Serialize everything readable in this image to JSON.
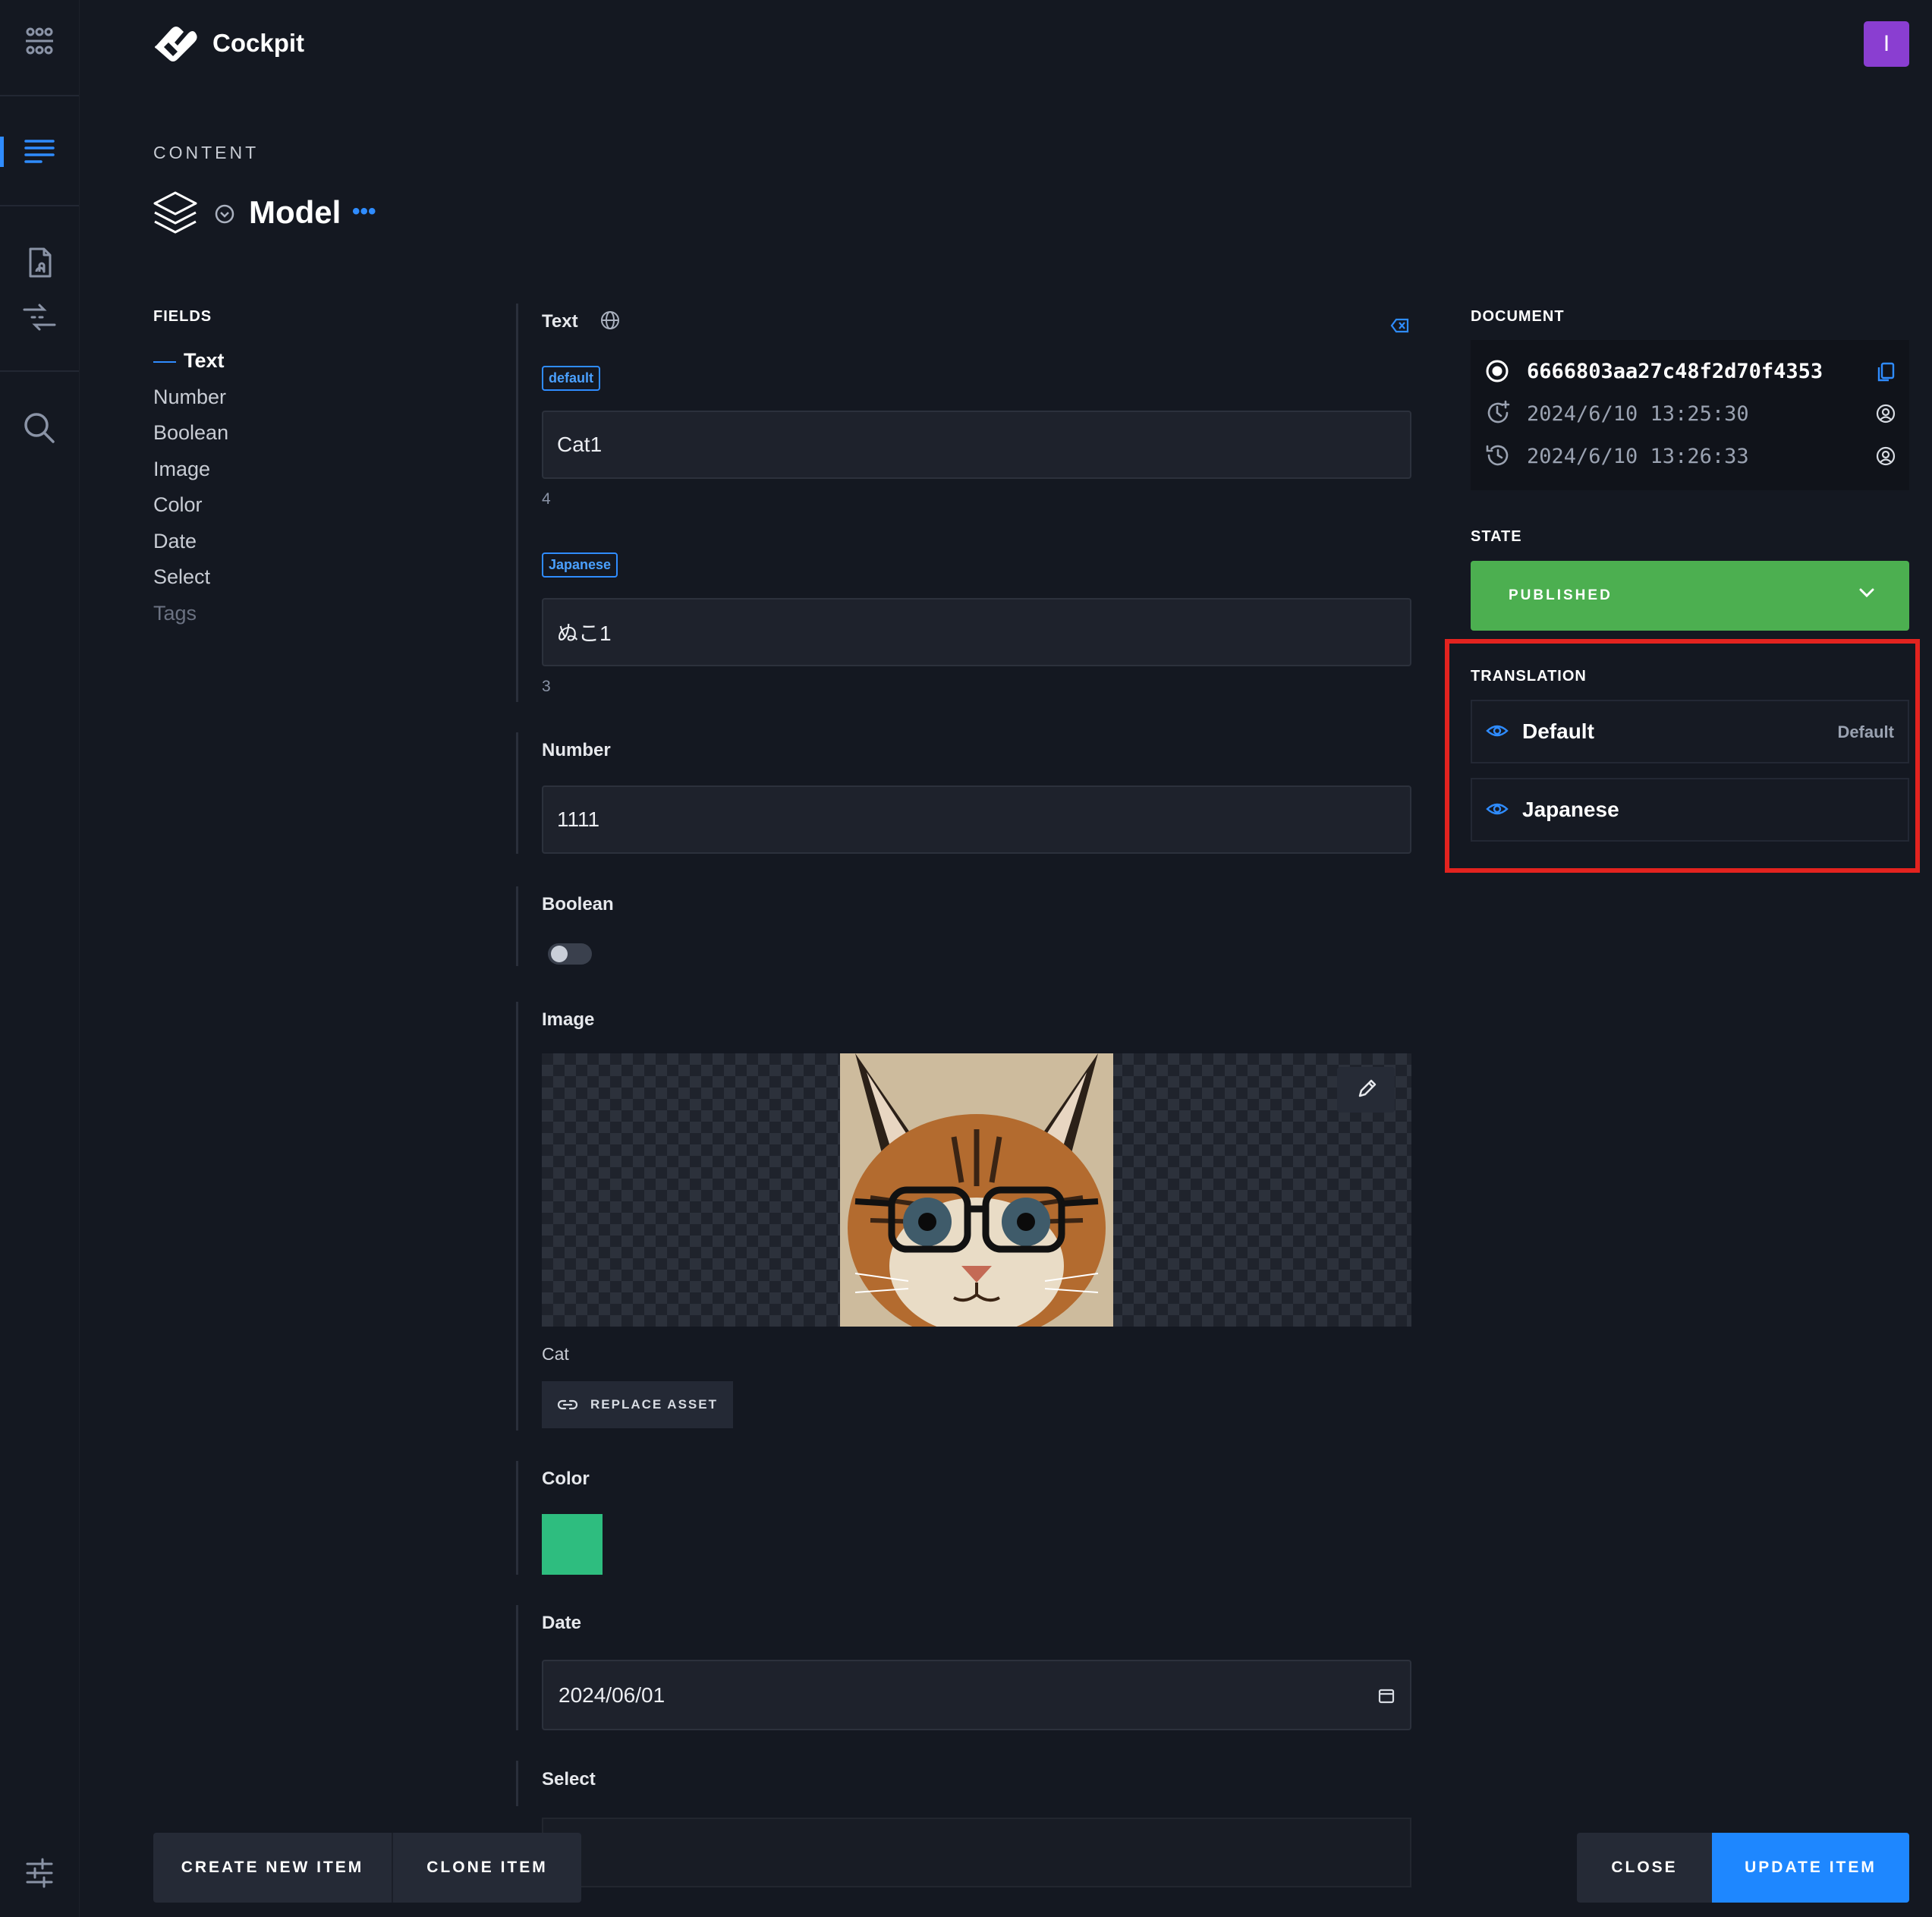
{
  "app": {
    "name": "Cockpit",
    "user_initial": "I"
  },
  "header": {
    "eyebrow": "CONTENT",
    "title": "Model",
    "more_label": "•••"
  },
  "fields_nav": {
    "heading": "FIELDS",
    "items": [
      {
        "label": "Text",
        "active": true
      },
      {
        "label": "Number"
      },
      {
        "label": "Boolean"
      },
      {
        "label": "Image"
      },
      {
        "label": "Color"
      },
      {
        "label": "Date"
      },
      {
        "label": "Select"
      },
      {
        "label": "Tags"
      }
    ]
  },
  "form": {
    "text": {
      "label": "Text",
      "locales": [
        {
          "badge": "default",
          "value": "Cat1",
          "count": "4"
        },
        {
          "badge": "Japanese",
          "value": "ぬこ1",
          "count": "3"
        }
      ]
    },
    "number": {
      "label": "Number",
      "value": "1111"
    },
    "boolean": {
      "label": "Boolean",
      "value": false
    },
    "image": {
      "label": "Image",
      "caption": "Cat",
      "replace_label": "REPLACE ASSET"
    },
    "color": {
      "label": "Color",
      "value": "#2ebd7f"
    },
    "date": {
      "label": "Date",
      "value": "2024/06/01"
    },
    "select": {
      "label": "Select"
    }
  },
  "document": {
    "heading": "DOCUMENT",
    "id": "6666803aa27c48f2d70f4353",
    "created": "2024/6/10 13:25:30",
    "modified": "2024/6/10 13:26:33"
  },
  "state": {
    "heading": "STATE",
    "value": "PUBLISHED",
    "color": "#4caf50"
  },
  "translation": {
    "heading": "TRANSLATION",
    "languages": [
      {
        "name": "Default",
        "tag": "Default"
      },
      {
        "name": "Japanese",
        "tag": ""
      }
    ]
  },
  "actions": {
    "create": "CREATE NEW ITEM",
    "clone": "CLONE ITEM",
    "close": "CLOSE",
    "update": "UPDATE ITEM"
  },
  "colors": {
    "accent": "#1e87ff",
    "highlight": "#e3231f",
    "background": "#141821"
  }
}
